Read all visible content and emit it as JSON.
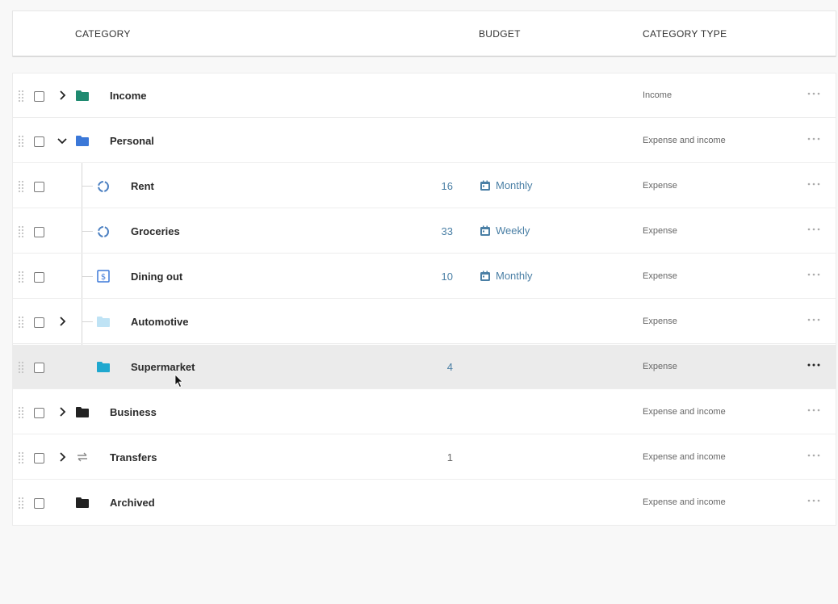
{
  "header": {
    "category": "CATEGORY",
    "budget": "BUDGET",
    "category_type": "CATEGORY TYPE"
  },
  "rows": [
    {
      "name": "Income",
      "amount": "",
      "period": "",
      "type": "Income",
      "icon": "folder-icon",
      "icon_color": "#1f8a70",
      "expand": "collapsed"
    },
    {
      "name": "Personal",
      "amount": "",
      "period": "",
      "type": "Expense and income",
      "icon": "folder-icon",
      "icon_color": "#3b78d8",
      "expand": "expanded"
    },
    {
      "name": "Rent",
      "amount": "16",
      "period": "Monthly",
      "type": "Expense",
      "icon": "donut-icon",
      "icon_color": "#4a7fc1"
    },
    {
      "name": "Groceries",
      "amount": "33",
      "period": "Weekly",
      "type": "Expense",
      "icon": "donut-icon",
      "icon_color": "#4a7fc1"
    },
    {
      "name": "Dining out",
      "amount": "10",
      "period": "Monthly",
      "type": "Expense",
      "icon": "dollar-bill-icon",
      "icon_color": "#3b78d8"
    },
    {
      "name": "Automotive",
      "amount": "",
      "period": "",
      "type": "Expense",
      "icon": "folder-icon",
      "icon_color": "#bfe3f5",
      "expand": "collapsed"
    },
    {
      "name": "Supermarket",
      "amount": "4",
      "period": "",
      "type": "Expense",
      "icon": "folder-icon",
      "icon_color": "#1fa8cf"
    },
    {
      "name": "Business",
      "amount": "",
      "period": "",
      "type": "Expense and income",
      "icon": "folder-icon",
      "icon_color": "#222222",
      "expand": "collapsed"
    },
    {
      "name": "Transfers",
      "amount": "1",
      "period": "",
      "type": "Expense and income",
      "icon": "transfer-arrows-icon",
      "icon_color": "#888888",
      "expand": "collapsed"
    },
    {
      "name": "Archived",
      "amount": "",
      "period": "",
      "type": "Expense and income",
      "icon": "folder-icon",
      "icon_color": "#222222"
    }
  ],
  "colors": {
    "accent": "#4a7fa5",
    "hover_row": "#ebebeb"
  }
}
